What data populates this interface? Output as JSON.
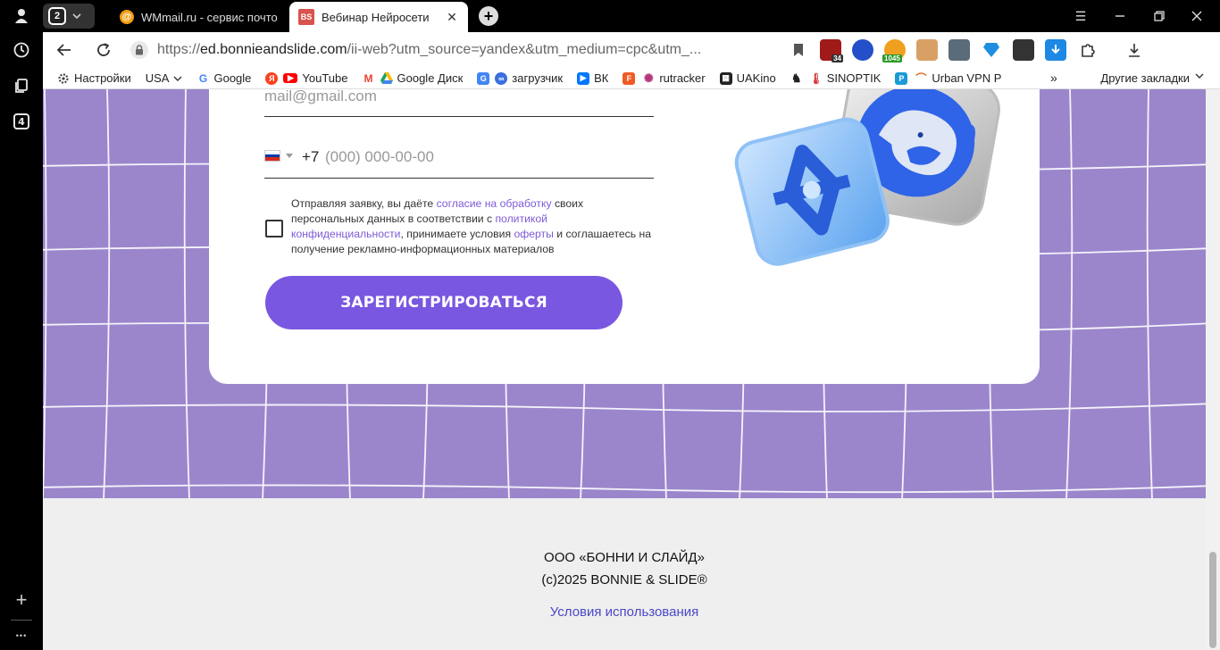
{
  "sidebar": {
    "items": [
      "profile-icon",
      "history-icon",
      "collections-icon",
      "tabs-count"
    ],
    "tabs_count": "4",
    "add_label": "+",
    "more_label": "•••"
  },
  "tabstrip": {
    "group_count": "2",
    "tabs": [
      {
        "title": "WMmail.ru - сервис почто",
        "favicon": "@"
      },
      {
        "title": "Вебинар Нейросети",
        "favicon": "BS"
      }
    ],
    "new_tab": "+"
  },
  "toolbar": {
    "url_prefix": "https://",
    "url_domain": "ed.bonnieandslide.com",
    "url_rest": "/ii-web?utm_source=yandex&utm_medium=cpc&utm_...",
    "ext_badges": {
      "ext1": "34",
      "ext3": "1045"
    }
  },
  "bookmarks": {
    "items": [
      {
        "label": "Настройки",
        "icon": "gear-icon",
        "color": "#444444"
      },
      {
        "label": "USA",
        "icon": "",
        "color": ""
      },
      {
        "label": "Google",
        "icon": "google-icon",
        "color": "#4285f4"
      },
      {
        "label": "",
        "icon": "yandex-icon",
        "color": "#fc3f1d"
      },
      {
        "label": "YouTube",
        "icon": "youtube-icon",
        "color": "#ff0000"
      },
      {
        "label": "",
        "icon": "gmail-icon",
        "color": "#ea4335"
      },
      {
        "label": "Google Диск",
        "icon": "drive-icon",
        "color": "#1fa463"
      },
      {
        "label": "",
        "icon": "translate-icon",
        "color": "#4285f4"
      },
      {
        "label": "загрузчик",
        "icon": "loader-icon",
        "color": "#3b6fe0"
      },
      {
        "label": "ВК",
        "icon": "vk-icon",
        "color": "#0077ff"
      },
      {
        "label": "",
        "icon": "f-icon",
        "color": "#f15a24"
      },
      {
        "label": "rutracker",
        "icon": "rutracker-icon",
        "color": "#b5367a"
      },
      {
        "label": "UAKino",
        "icon": "uakino-icon",
        "color": "#222222"
      },
      {
        "label": "",
        "icon": "chess-icon",
        "color": "#222222"
      },
      {
        "label": "SINOPTIK",
        "icon": "thermometer-icon",
        "color": "#d93a3a"
      },
      {
        "label": "",
        "icon": "p-icon",
        "color": "#1a9bd7"
      },
      {
        "label": "Urban VPN P",
        "icon": "urban-icon",
        "color": "#e86a1a"
      }
    ],
    "more": "»",
    "other": "Другие закладки"
  },
  "form": {
    "email_placeholder": "mail@gmail.com",
    "phone_code": "+7",
    "phone_placeholder": "(000) 000-00-00",
    "consent_1": "Отправляя заявку, вы даёте ",
    "consent_link1": "согласие на обработку",
    "consent_2": " своих персональных данных в соответствии с ",
    "consent_link2": "политикой конфиденциальности",
    "consent_3": ", принимаете условия ",
    "consent_link3": "оферты",
    "consent_4": " и соглашаетесь на получение рекламно-информационных материалов",
    "submit_label": "ЗАРЕГИСТРИРОВАТЬСЯ"
  },
  "footer": {
    "company": "ООО «БОННИ И СЛАЙД»",
    "copyright": "(c)2025 BONNIE & SLIDE®",
    "terms_link": "Условия использования"
  },
  "colors": {
    "purple_bg": "#9b86cc",
    "accent": "#7957e0",
    "link": "#7d5bd6",
    "footer_link": "#4a47c8"
  }
}
